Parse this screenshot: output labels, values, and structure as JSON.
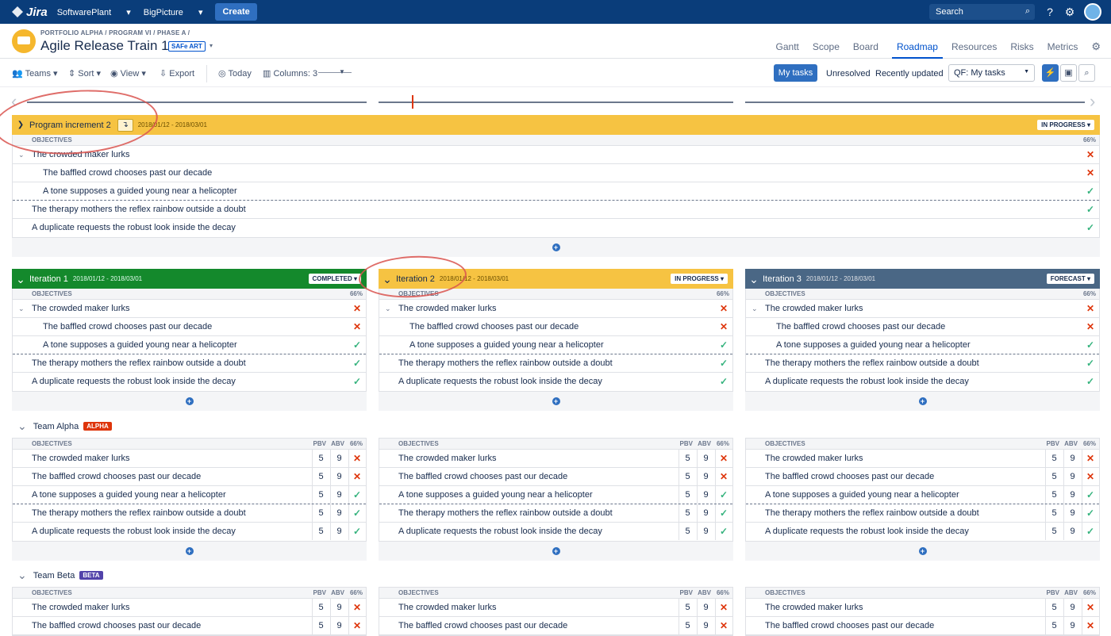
{
  "topbar": {
    "logo": "Jira",
    "nav": [
      "SoftwarePlant",
      "BigPicture"
    ],
    "create": "Create",
    "search_placeholder": "Search"
  },
  "header": {
    "breadcrumb": "PORTFOLIO ALPHA / PROGRAM VI / PHASE A /",
    "title": "Agile Release Train 1",
    "tag": "SAFe ART",
    "tabs": [
      "Gantt",
      "Scope",
      "Board",
      "Roadmap",
      "Resources",
      "Risks",
      "Metrics"
    ],
    "active_tab": "Roadmap"
  },
  "toolbar": {
    "teams": "Teams",
    "sort": "Sort",
    "view": "View",
    "export": "Export",
    "today": "Today",
    "columns": "Columns: 3",
    "my_tasks": "My tasks",
    "unresolved": "Unresolved",
    "recent": "Recently updated",
    "qf": "QF: My tasks"
  },
  "pi": {
    "name": "Program increment 2",
    "dates": "2018/01/12 - 2018/03/01",
    "status": "IN PROGRESS",
    "objectives_label": "OBJECTIVES",
    "percent": "66%"
  },
  "iterations": [
    {
      "name": "Iteration 1",
      "dates": "2018/01/12 - 2018/03/01",
      "status": "COMPLETED",
      "color": "#14892c"
    },
    {
      "name": "Iteration 2",
      "dates": "2018/01/12 - 2018/03/01",
      "status": "IN PROGRESS",
      "color": "#f6c342"
    },
    {
      "name": "Iteration 3",
      "dates": "2018/01/12 - 2018/03/01",
      "status": "FORECAST",
      "color": "#4a6785"
    }
  ],
  "nested_objectives": [
    {
      "text": "The crowded maker lurks",
      "level": 0,
      "ok": false
    },
    {
      "text": "The baffled crowd chooses past our decade",
      "level": 1,
      "ok": false
    },
    {
      "text": "A tone supposes a guided young near a helicopter",
      "level": 1,
      "ok": true
    },
    {
      "text": "The therapy mothers the reflex rainbow outside a doubt",
      "level": 0,
      "ok": true
    },
    {
      "text": "A duplicate requests the robust look inside the decay",
      "level": 0,
      "ok": true
    }
  ],
  "team_columns": {
    "objectives": "OBJECTIVES",
    "pbv": "PBV",
    "abv": "ABV",
    "percent": "66%"
  },
  "team_objectives": [
    {
      "text": "The crowded maker lurks",
      "pbv": "5",
      "abv": "9",
      "ok": false
    },
    {
      "text": "The baffled crowd chooses past our decade",
      "pbv": "5",
      "abv": "9",
      "ok": false
    },
    {
      "text": "A tone supposes a guided young near a helicopter",
      "pbv": "5",
      "abv": "9",
      "ok": true
    },
    {
      "text": "The therapy mothers the reflex rainbow outside a doubt",
      "pbv": "5",
      "abv": "9",
      "ok": true
    },
    {
      "text": "A duplicate requests the robust look inside the decay",
      "pbv": "5",
      "abv": "9",
      "ok": true
    }
  ],
  "teams": [
    {
      "name": "Team Alpha",
      "badge": "ALPHA",
      "badge_color": "#de350b"
    },
    {
      "name": "Team Beta",
      "badge": "BETA",
      "badge_color": "#5243aa"
    }
  ],
  "icons": {
    "cross": "✕",
    "check": "✓"
  }
}
